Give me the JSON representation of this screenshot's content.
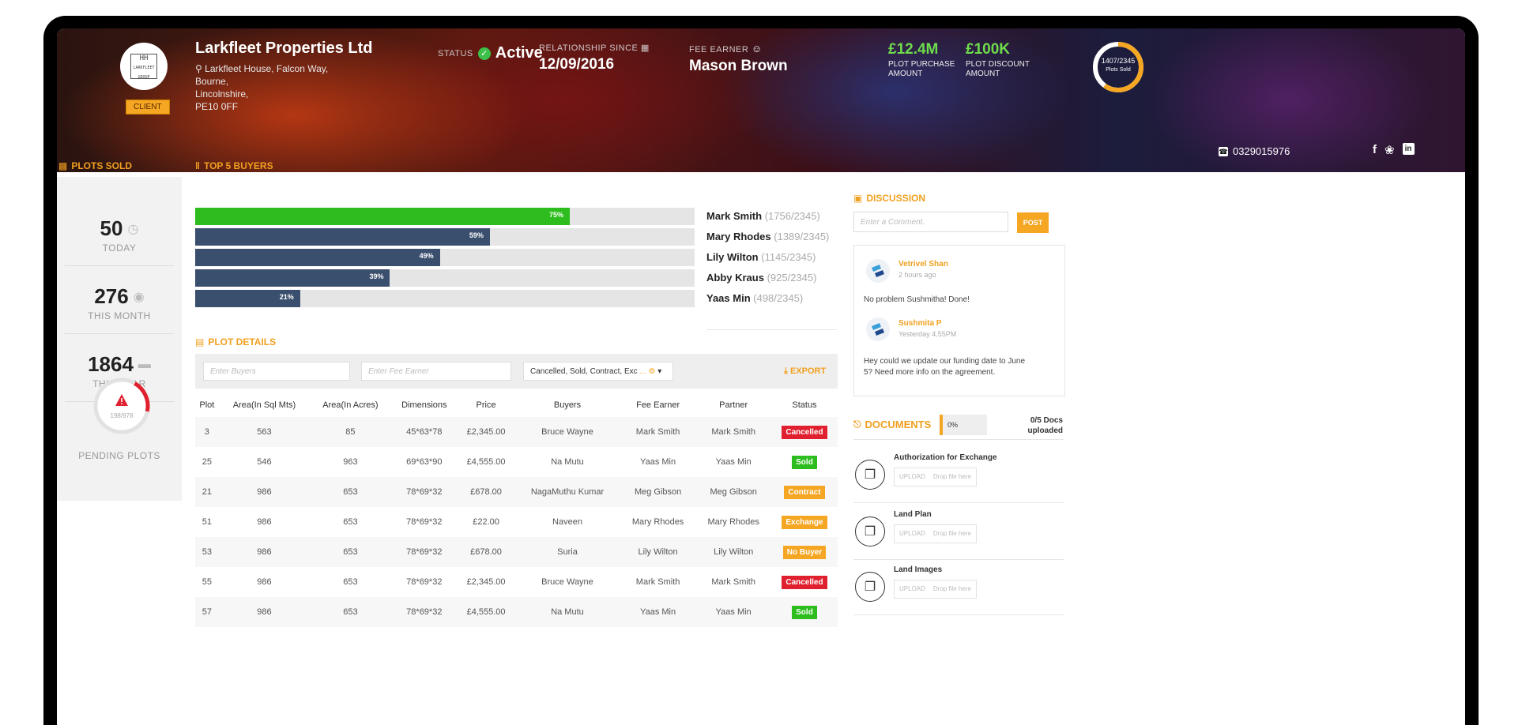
{
  "header": {
    "logo_text": "HH",
    "logo_sub": "LARKFLEET GROUP",
    "client_badge": "CLIENT",
    "company_name": "Larkfleet Properties Ltd",
    "address_line1": "Larkfleet House, Falcon Way,",
    "address_line2": "Bourne,",
    "address_line3": "Lincolnshire,",
    "address_line4": "PE10 0FF",
    "status_label": "STATUS",
    "status_value": "Active",
    "relationship_label": "RELATIONSHIP SINCE",
    "relationship_value": "12/09/2016",
    "fee_earner_label": "FEE EARNER",
    "fee_earner_value": "Mason Brown",
    "plot_purchase_value": "£12.4M",
    "plot_purchase_label1": "PLOT PURCHASE",
    "plot_purchase_label2": "AMOUNT",
    "plot_discount_value": "£100K",
    "plot_discount_label1": "PLOT DISCOUNT",
    "plot_discount_label2": "AMOUNT",
    "plots_sold_ratio": "1407/2345",
    "plots_sold_ring_label": "Plots Sold",
    "plots_sold_fraction": 0.6,
    "phone": "0329015976"
  },
  "plots_sold": {
    "title": "PLOTS SOLD",
    "today_value": "50",
    "today_label": "TODAY",
    "month_value": "276",
    "month_label": "THIS MONTH",
    "year_value": "1864",
    "year_label": "THIS YEAR",
    "pending_ratio": "198/978",
    "pending_label": "PENDING PLOTS",
    "pending_fraction": 0.2
  },
  "top_buyers": {
    "title": "TOP 5 BUYERS",
    "items": [
      {
        "pct": 75,
        "pct_label": "75%",
        "name": "Mark Smith",
        "count": "(1756/2345)",
        "color": "#2dbd1e"
      },
      {
        "pct": 59,
        "pct_label": "59%",
        "name": "Mary Rhodes",
        "count": "(1389/2345)",
        "color": "#3a4f6e"
      },
      {
        "pct": 49,
        "pct_label": "49%",
        "name": "Lily Wilton",
        "count": "(1145/2345)",
        "color": "#3a4f6e"
      },
      {
        "pct": 39,
        "pct_label": "39%",
        "name": "Abby Kraus",
        "count": "(925/2345)",
        "color": "#3a4f6e"
      },
      {
        "pct": 21,
        "pct_label": "21%",
        "name": "Yaas Min",
        "count": "(498/2345)",
        "color": "#3a4f6e"
      }
    ]
  },
  "plot_details": {
    "title": "PLOT DETAILS",
    "buyers_placeholder": "Enter Buyers",
    "fee_earner_placeholder": "Enter Fee Earner",
    "status_filter": "Cancelled, Sold, Contract, Exc",
    "export_label": "EXPORT",
    "columns": [
      "Plot",
      "Area(In Sql Mts)",
      "Area(In Acres)",
      "Dimensions",
      "Price",
      "Buyers",
      "Fee Earner",
      "Partner",
      "Status"
    ],
    "rows": [
      {
        "plot": "3",
        "sqm": "563",
        "acres": "85",
        "dim": "45*63*78",
        "price": "£2,345.00",
        "buyer": "Bruce Wayne",
        "fee": "Mark Smith",
        "partner": "Mark Smith",
        "status": "Cancelled",
        "color": "#e0202e"
      },
      {
        "plot": "25",
        "sqm": "546",
        "acres": "963",
        "dim": "69*63*90",
        "price": "£4,555.00",
        "buyer": "Na Mutu",
        "fee": "Yaas Min",
        "partner": "Yaas Min",
        "status": "Sold",
        "color": "#2dbd1e"
      },
      {
        "plot": "21",
        "sqm": "986",
        "acres": "653",
        "dim": "78*69*32",
        "price": "£678.00",
        "buyer": "NagaMuthu Kumar",
        "fee": "Meg Gibson",
        "partner": "Meg Gibson",
        "status": "Contract",
        "color": "#f5a623"
      },
      {
        "plot": "51",
        "sqm": "986",
        "acres": "653",
        "dim": "78*69*32",
        "price": "£22.00",
        "buyer": "Naveen",
        "fee": "Mary Rhodes",
        "partner": "Mary Rhodes",
        "status": "Exchange",
        "color": "#f5a623"
      },
      {
        "plot": "53",
        "sqm": "986",
        "acres": "653",
        "dim": "78*69*32",
        "price": "£678.00",
        "buyer": "Suria",
        "fee": "Lily Wilton",
        "partner": "Lily Wilton",
        "status": "No Buyer",
        "color": "#f5a623"
      },
      {
        "plot": "55",
        "sqm": "986",
        "acres": "653",
        "dim": "78*69*32",
        "price": "£2,345.00",
        "buyer": "Bruce Wayne",
        "fee": "Mark Smith",
        "partner": "Mark Smith",
        "status": "Cancelled",
        "color": "#e0202e"
      },
      {
        "plot": "57",
        "sqm": "986",
        "acres": "653",
        "dim": "78*69*32",
        "price": "£4,555.00",
        "buyer": "Na Mutu",
        "fee": "Yaas Min",
        "partner": "Yaas Min",
        "status": "Sold",
        "color": "#2dbd1e"
      }
    ]
  },
  "discussion": {
    "title": "DISCUSSION",
    "comment_placeholder": "Enter a Comment.",
    "post_label": "POST",
    "messages": [
      {
        "name": "Vetrivel Shan",
        "time": "2 hours ago",
        "text": "No problem Sushmitha! Done!"
      },
      {
        "name": "Sushmita P",
        "time": "Yesterday 4.55PM",
        "text1": "Hey could we update our funding date to June",
        "text2": "5? Need more info on the agreement."
      }
    ]
  },
  "documents": {
    "title": "DOCUMENTS",
    "progress": "0%",
    "count_line1": "0/5 Docs",
    "count_line2": "uploaded",
    "upload_label": "UPLOAD",
    "drop_label": "Drop file here",
    "items": [
      {
        "title": "Authorization for Exchange"
      },
      {
        "title": "Land Plan"
      },
      {
        "title": "Land Images"
      }
    ]
  }
}
